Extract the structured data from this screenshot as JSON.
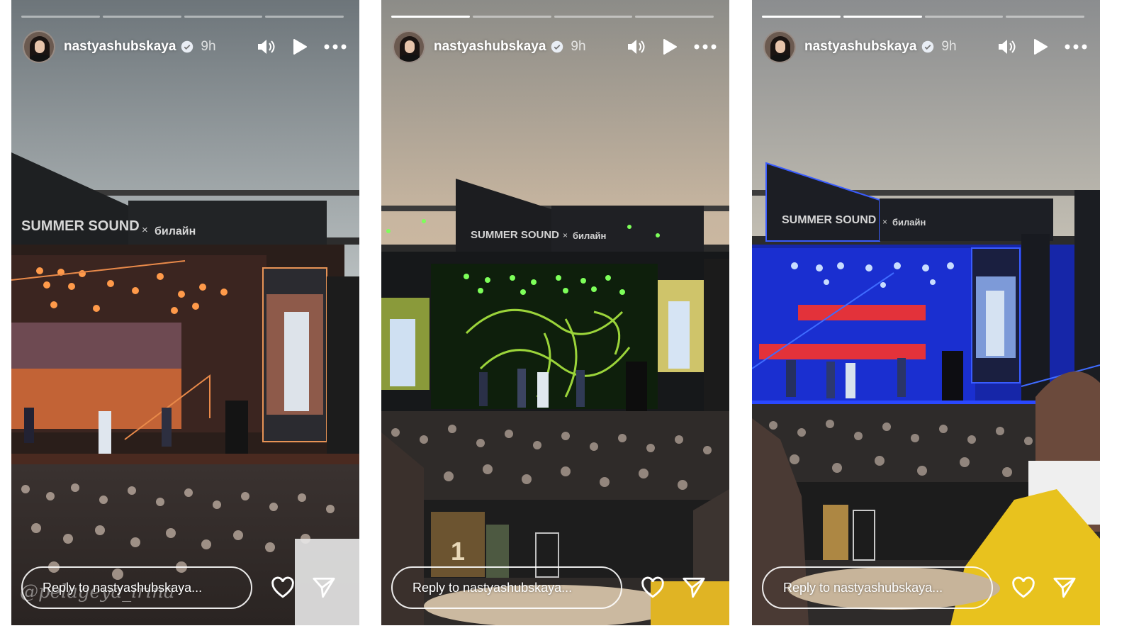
{
  "stories": [
    {
      "username": "nastyashubskaya",
      "time": "9h",
      "progress_segments_done": 0,
      "progress_segments_total": 4,
      "reply_placeholder": "Reply to nastyashubskaya...",
      "banner_text": "SUMMER SOUND",
      "banner_x": "×",
      "banner_sponsor": "билайн",
      "light_color": "#ff9a4a",
      "screen_color": "#f07b3a",
      "watermark": "@pelageya_irina"
    },
    {
      "username": "nastyashubskaya",
      "time": "9h",
      "progress_segments_done": 1,
      "progress_segments_total": 4,
      "reply_placeholder": "Reply to nastyashubskaya...",
      "banner_text": "SUMMER SOUND",
      "banner_x": "×",
      "banner_sponsor": "билайн",
      "light_color": "#7dff5a",
      "screen_color": "#9bd43a",
      "table_number": "1"
    },
    {
      "username": "nastyashubskaya",
      "time": "9h",
      "progress_segments_done": 2,
      "progress_segments_total": 4,
      "reply_placeholder": "Reply to nastyashubskaya...",
      "banner_text": "SUMMER SOUND",
      "banner_x": "×",
      "banner_sponsor": "билайн",
      "light_color": "#c8dcff",
      "screen_color": "#e3323a"
    }
  ],
  "icons": {
    "mute": "speaker-icon",
    "play": "play-icon",
    "more": "more-icon",
    "like": "heart-icon",
    "share": "send-icon",
    "verified": "verified-badge-icon"
  }
}
